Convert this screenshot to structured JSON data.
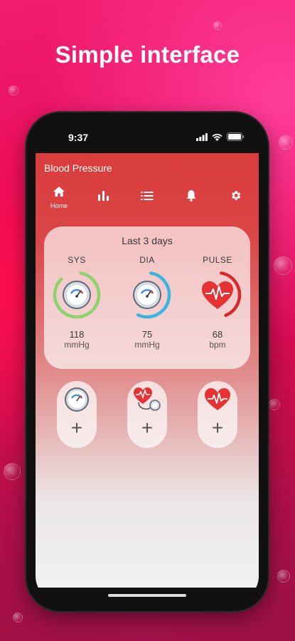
{
  "headline": "Simple interface",
  "status": {
    "time": "9:37"
  },
  "app": {
    "title": "Blood Pressure",
    "tabs": [
      {
        "icon": "home-icon",
        "label": "Home",
        "active": true
      },
      {
        "icon": "bar-chart-icon",
        "label": ""
      },
      {
        "icon": "list-icon",
        "label": ""
      },
      {
        "icon": "bell-icon",
        "label": ""
      },
      {
        "icon": "gear-icon",
        "label": ""
      }
    ]
  },
  "summary": {
    "title": "Last 3 days",
    "metrics": [
      {
        "name": "SYS",
        "value": "118",
        "unit": "mmHg",
        "ring_color": "#8fd16a",
        "icon": "gauge-icon"
      },
      {
        "name": "DIA",
        "value": "75",
        "unit": "mmHg",
        "ring_color": "#38b6e0",
        "icon": "gauge-icon"
      },
      {
        "name": "PULSE",
        "value": "68",
        "unit": "bpm",
        "ring_color": "#d62b2b",
        "icon": "heart-pulse-icon"
      }
    ]
  },
  "add_buttons": [
    {
      "icon": "gauge-icon",
      "symbol": "+"
    },
    {
      "icon": "heart-stethoscope-icon",
      "symbol": "+"
    },
    {
      "icon": "heart-pulse-icon",
      "symbol": "+"
    }
  ],
  "colors": {
    "accent": "#d93c3c",
    "background": "#e40b5a"
  }
}
